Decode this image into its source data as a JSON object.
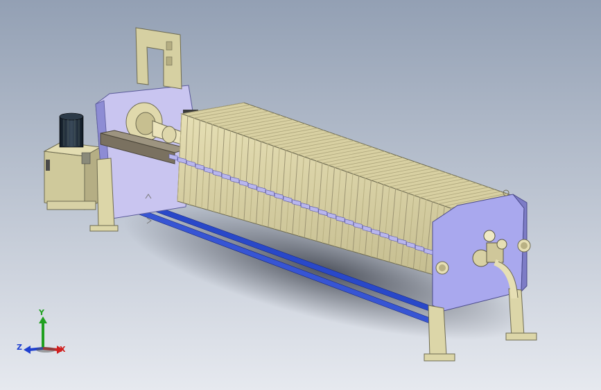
{
  "viewport": {
    "background_top": "#93a0b4",
    "background_bottom": "#e6e9ef",
    "model_colors": {
      "frame": "#a9a8ee",
      "frame_dark": "#7d7cc6",
      "plates": "#ddd6a8",
      "plates_dark": "#b9b184",
      "base": "#d9d4a8",
      "rails": "#2948c9",
      "beam": "#8a8170",
      "motor": "#1d2a37"
    }
  },
  "triad": {
    "y_label": "Y",
    "x_label": "X",
    "z_label": "Z",
    "y_color": "#20a020",
    "x_color": "#d02020",
    "z_color": "#2040d0"
  }
}
